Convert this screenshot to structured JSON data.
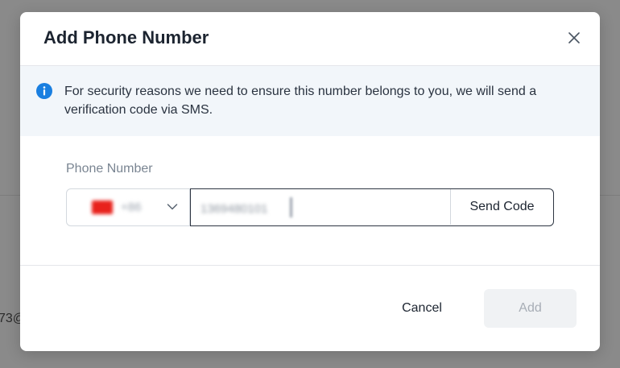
{
  "background": {
    "partial_text": "73@"
  },
  "dialog": {
    "title": "Add Phone Number",
    "close_icon": "close-icon",
    "info": {
      "icon": "info-icon",
      "text": "For security reasons we need to ensure this number belongs to you, we will send a verification code via SMS."
    },
    "phone_field": {
      "label": "Phone Number",
      "country": {
        "flag_icon": "china-flag-icon",
        "dial_code": "+86"
      },
      "value": "1369480101",
      "send_code_label": "Send Code"
    },
    "footer": {
      "cancel_label": "Cancel",
      "add_label": "Add"
    }
  },
  "colors": {
    "info_accent": "#1a7fe0",
    "banner_bg": "#f2f6fa",
    "overlay": "#8a8a8a",
    "disabled_button_bg": "#f0f2f4"
  }
}
